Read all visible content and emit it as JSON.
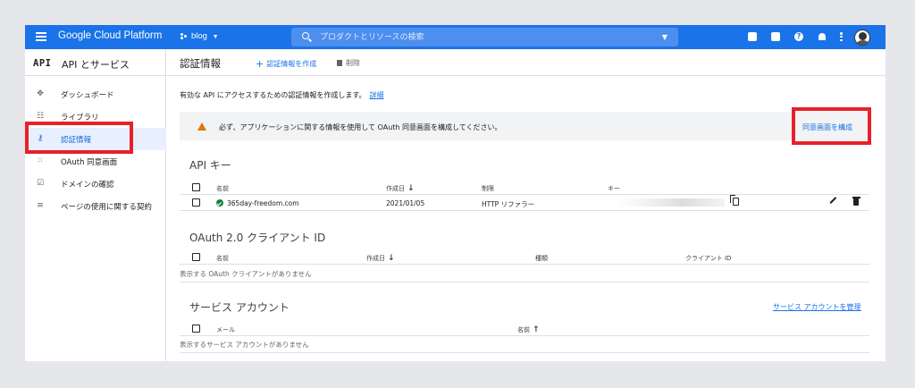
{
  "topbar": {
    "title": "Google Cloud Platform",
    "project": "blog",
    "search_placeholder": "プロダクトとリソースの検索",
    "icons": [
      "menu-icon",
      "project-dots-icon",
      "search-icon",
      "chevron-down-icon",
      "gift-icon",
      "terminal-icon",
      "help-icon",
      "bell-icon",
      "more-vert-icon",
      "avatar"
    ]
  },
  "sidebar": {
    "api_glyph": "API",
    "title": "API とサービス",
    "items": [
      {
        "label": "ダッシュボード",
        "icon": "dashboard-icon"
      },
      {
        "label": "ライブラリ",
        "icon": "library-icon"
      },
      {
        "label": "認証情報",
        "icon": "key-icon",
        "active": true
      },
      {
        "label": "OAuth 同意画面",
        "icon": "consent-icon"
      },
      {
        "label": "ドメインの確認",
        "icon": "domain-check-icon"
      },
      {
        "label": "ページの使用に関する契約",
        "icon": "agreements-icon"
      }
    ]
  },
  "main": {
    "title": "認証情報",
    "create_label": "認証情報を作成",
    "delete_label": "削除",
    "intro_text": "有効な API にアクセスするための認証情報を作成します。",
    "intro_link": "詳細",
    "warning_text": "必ず、アプリケーションに関する情報を使用して OAuth 同意画面を構成してください。",
    "warning_link": "同意画面を構成",
    "api_keys": {
      "title": "API キー",
      "columns": [
        "名前",
        "作成日",
        "制限",
        "キー"
      ],
      "rows": [
        {
          "name": "365day-freedom.com",
          "created": "2021/01/05",
          "restriction": "HTTP リファラー"
        }
      ]
    },
    "oauth": {
      "title": "OAuth 2.0 クライアント ID",
      "columns": [
        "名前",
        "作成日",
        "種類",
        "クライアント ID"
      ],
      "empty": "表示する OAuth クライアントがありません"
    },
    "service_accounts": {
      "title": "サービス アカウント",
      "manage_link": "サービス アカウントを管理",
      "columns": [
        "メール",
        "名前"
      ],
      "empty": "表示するサービス アカウントがありません"
    }
  },
  "colors": {
    "brand_blue": "#1a73e8",
    "highlight_red": "#e8202a",
    "warning_orange": "#e37400",
    "ok_green": "#188038"
  }
}
